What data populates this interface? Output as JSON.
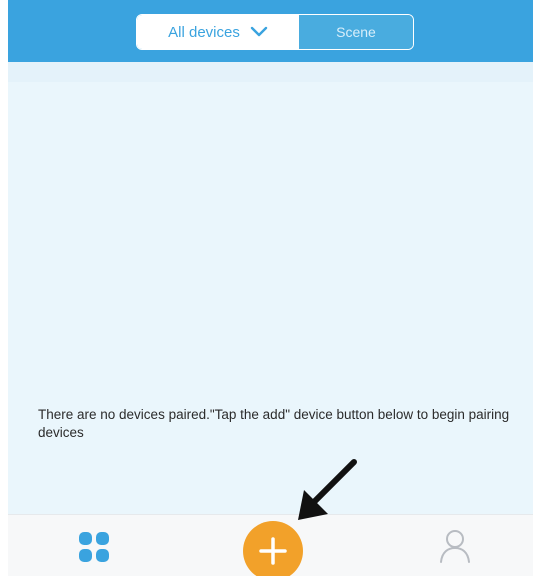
{
  "header": {
    "tabs": [
      {
        "label": "All devices",
        "active": true
      },
      {
        "label": "Scene",
        "active": false
      }
    ],
    "accent_color": "#3aa3df"
  },
  "empty_state": {
    "message": "There are no devices paired.\"Tap the add\" device button below to begin pairing devices"
  },
  "bottom_nav": {
    "items": [
      {
        "name": "devices",
        "icon": "grid-icon"
      },
      {
        "name": "add",
        "icon": "plus-icon",
        "color": "#f2a12a"
      },
      {
        "name": "profile",
        "icon": "person-icon"
      }
    ]
  }
}
